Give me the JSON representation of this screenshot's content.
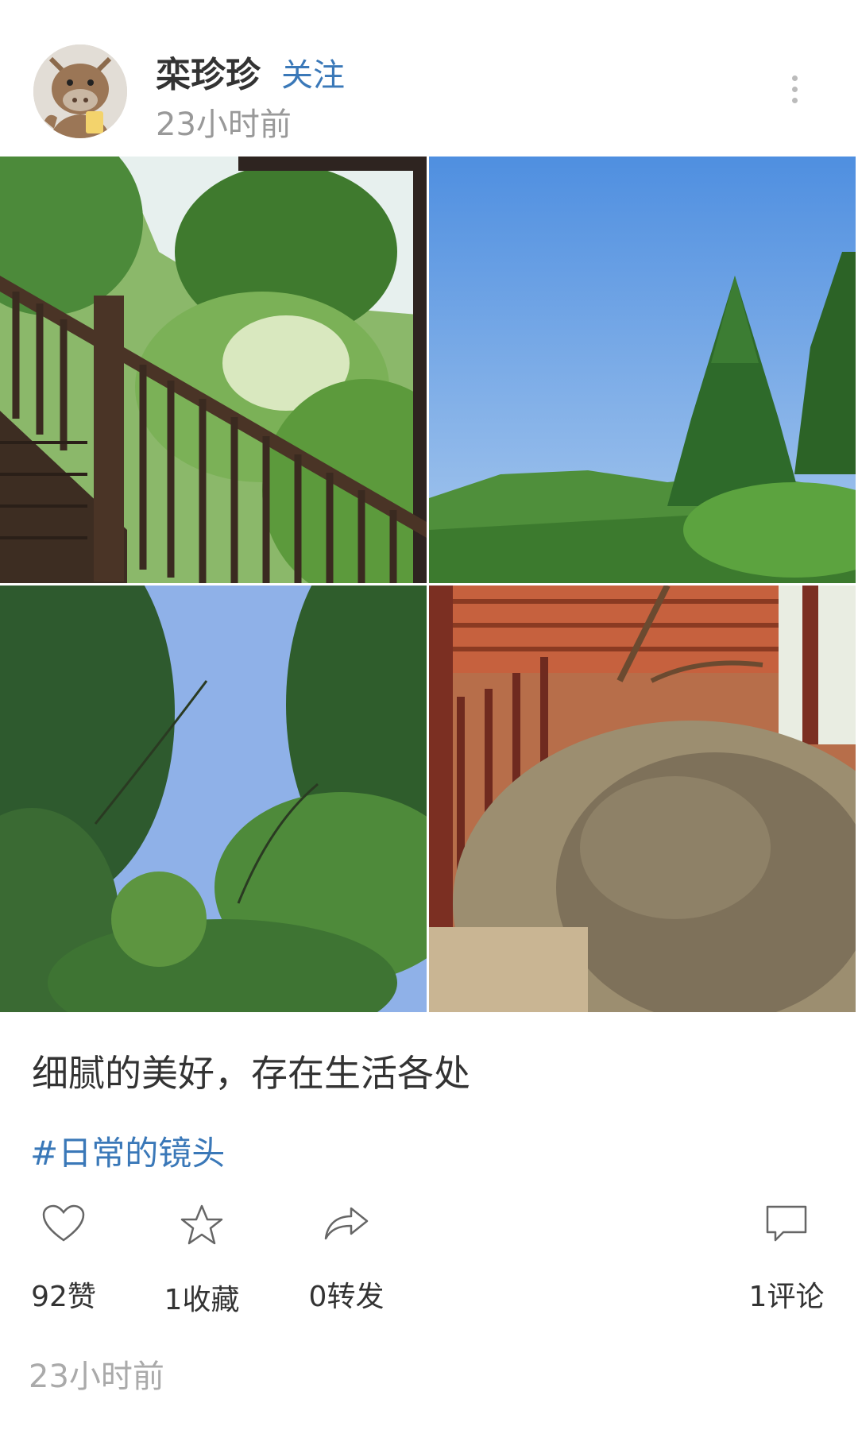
{
  "post": {
    "author": "栾珍珍",
    "follow_label": "关注",
    "time_top": "23小时前",
    "caption": "细腻的美好，存在生活各处",
    "tag": "#日常的镜头",
    "time_bottom": "23小时前"
  },
  "actions": {
    "like": "92赞",
    "favorite": "1收藏",
    "share": "0转发",
    "comment": "1评论"
  },
  "icons": [
    "more-vertical-icon",
    "heart-icon",
    "star-icon",
    "share-icon",
    "comment-icon"
  ],
  "colors": {
    "link": "#3a78b8",
    "muted": "#999999",
    "text": "#333333"
  }
}
